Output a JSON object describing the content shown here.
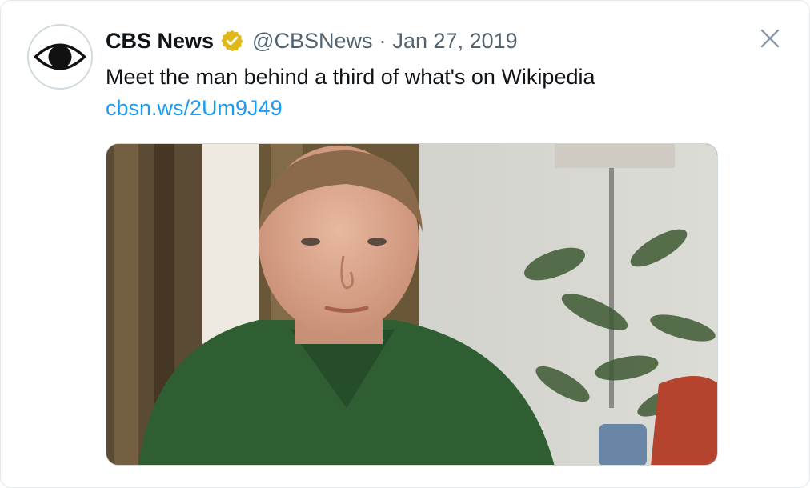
{
  "tweet": {
    "display_name": "CBS News",
    "handle": "@CBSNews",
    "separator": "·",
    "date": "Jan 27, 2019",
    "text": "Meet the man behind a third of what's on Wikipedia",
    "link_text": "cbsn.ws/2Um9J49",
    "verified_badge_color": "#e2b719",
    "link_color": "#1d9bf0"
  },
  "icons": {
    "avatar": "cbs-eye-logo",
    "verified": "verified-badge-icon",
    "close": "close-icon"
  }
}
